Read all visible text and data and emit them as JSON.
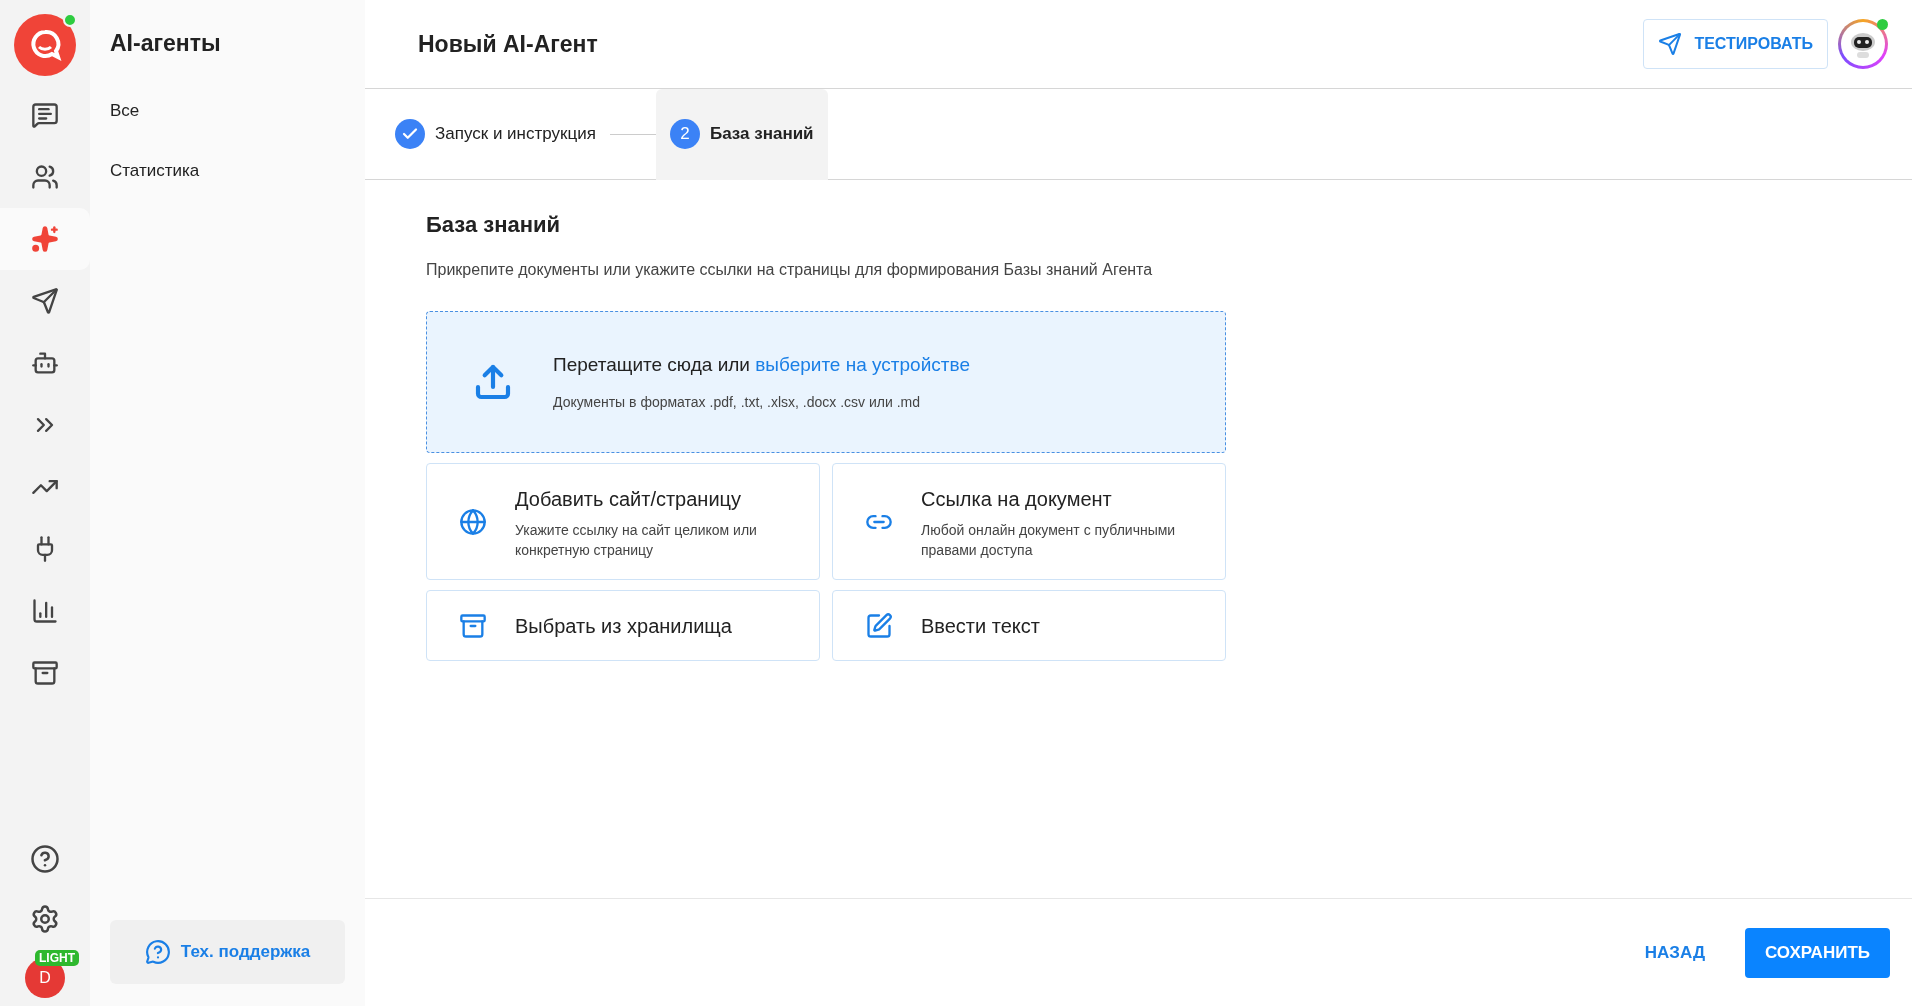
{
  "rail": {
    "items": [
      {
        "selected": false
      },
      {
        "selected": false
      },
      {
        "selected": true
      },
      {
        "selected": false
      },
      {
        "selected": false
      },
      {
        "selected": false
      },
      {
        "selected": false
      },
      {
        "selected": false
      },
      {
        "selected": false
      },
      {
        "selected": false
      }
    ],
    "user": {
      "initial": "D",
      "badge": "LIGHT"
    }
  },
  "sidebar": {
    "title": "AI-агенты",
    "items": [
      "Все",
      "Статистика"
    ],
    "support": "Тех. поддержка"
  },
  "header": {
    "title": "Новый AI-Агент",
    "test_button": "ТЕСТИРОВАТЬ"
  },
  "steps": [
    {
      "label": "Запуск и инструкция",
      "done": true,
      "selected": false
    },
    {
      "number": "2",
      "label": "База знаний",
      "done": false,
      "selected": true
    }
  ],
  "section": {
    "title": "База знаний",
    "description": "Прикрепите документы или укажите ссылки на страницы для формирования Базы знаний Агента"
  },
  "dropzone": {
    "text": "Перетащите сюда или ",
    "link": "выберите на устройстве",
    "hint": "Документы в форматах .pdf, .txt, .xlsx, .docx .csv или .md"
  },
  "options": [
    {
      "title": "Добавить сайт/страницу",
      "description": "Укажите ссылку на сайт целиком или конкретную страницу"
    },
    {
      "title": "Ссылка на документ",
      "description": "Любой онлайн документ с публичными правами доступа"
    },
    {
      "title": "Выбрать из хранилища"
    },
    {
      "title": "Ввести текст"
    }
  ],
  "footer": {
    "back": "НАЗАД",
    "save": "СОХРАНИТЬ"
  }
}
